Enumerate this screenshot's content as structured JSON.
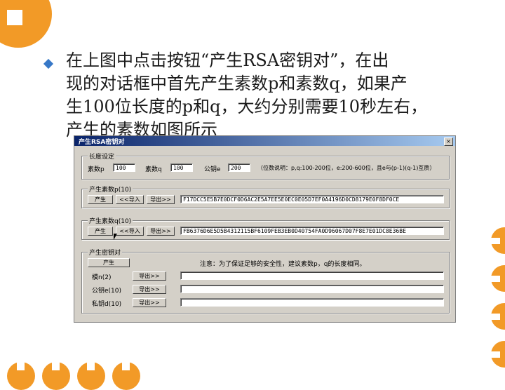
{
  "slide": {
    "lines": [
      "在上图中点击按钮“产生RSA密钥对”，在出",
      "现的对话框中首先产生素数p和素数q，如果产",
      "生100位长度的p和q，大约分别需要10秒左右，",
      "产生的素数如图所示"
    ]
  },
  "window": {
    "title": "产生RSA密钥对",
    "close_label": "×",
    "length_group": {
      "label": "长度设定",
      "prime_p_label": "素数p",
      "prime_p_value": "100",
      "prime_q_label": "素数q",
      "prime_q_value": "100",
      "public_key_label": "公钥e",
      "public_key_value": "200",
      "hint": "（位数说明：p,q:100-200位，e:200-600位，且e与(p-1)(q-1)互质）"
    },
    "p_group": {
      "label": "产生素数p(10)",
      "generate_btn": "产生",
      "import_btn": "<<导入",
      "export_btn": "导出>>",
      "value": "F17DCC5E5B7E0DCF0D6AC2E5A7EE5E0EC0E05D7EF0A4196D0CD8179E0F8DF0CE"
    },
    "q_group": {
      "label": "产生素数q(10)",
      "generate_btn": "产生",
      "import_btn": "<<导入",
      "export_btn": "导出>>",
      "value": "FB6376D6E5D5B4312115BF6109FEB3EB0D40754FA0D96067D07F8E7E01DC8E36BE"
    },
    "keypair_group": {
      "label": "产生密钥对",
      "generate_btn": "产生",
      "note": "注意：为了保证足够的安全性，建议素数p，q的长度相同。",
      "rows": [
        {
          "label": "模n(2)",
          "export_btn": "导出>>",
          "value": ""
        },
        {
          "label": "公钥e(10)",
          "export_btn": "导出>>",
          "value": ""
        },
        {
          "label": "私钥d(10)",
          "export_btn": "导出>>",
          "value": ""
        }
      ]
    }
  },
  "colors": {
    "accent": "#f29a27",
    "bullet": "#3778c7",
    "window_face": "#d4d0c8",
    "title_start": "#0a246a",
    "title_end": "#a6caf0"
  }
}
